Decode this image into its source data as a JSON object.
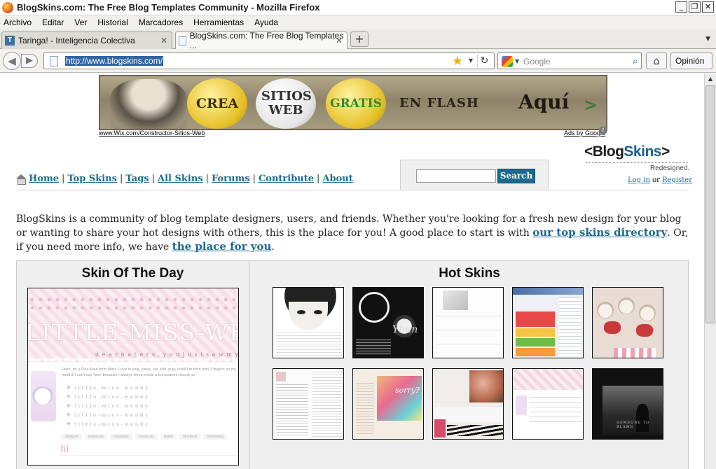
{
  "window": {
    "title": "BlogSkins.com: The Free Blog Templates Community - Mozilla Firefox",
    "buttons": [
      "_",
      "❐",
      "✕"
    ]
  },
  "menu": [
    "Archivo",
    "Editar",
    "Ver",
    "Historial",
    "Marcadores",
    "Herramientas",
    "Ayuda"
  ],
  "tabs": [
    {
      "label": "Taringa! - Inteligencia Colectiva",
      "icon": "T",
      "icon_color": "#3c6ea8",
      "active": false
    },
    {
      "label": "BlogSkins.com: The Free Blog Templates ...",
      "icon": "",
      "icon_color": "#ffffff",
      "active": true
    }
  ],
  "newtab_label": "+",
  "navbar": {
    "url": "http://www.blogskins.com/",
    "search_placeholder": "Google",
    "opinion_label": "Opinión"
  },
  "ad": {
    "bubble1": "CREA",
    "bubble2": "SITIOS WEB",
    "bubble3": "GRATIS",
    "flash": "EN FLASH",
    "aqui": "Aquí",
    "aqui_arrow": ">",
    "url": "www.Wix.com/Constructor-Sitios-Web",
    "ads_by": "Ads by Google"
  },
  "header": {
    "logo_lt": "<",
    "logo_blog": "Blog",
    "logo_skins": "Skins",
    "logo_gt": ">",
    "tagline": "Redesigned.",
    "login": "Log in",
    "or": "or",
    "register": "Register"
  },
  "nav": [
    "Home",
    "Top Skins",
    "Tags",
    "All Skins",
    "Forums",
    "Contribute",
    "About"
  ],
  "search_button": "Search",
  "intro": {
    "text1": "BlogSkins is a community of blog template designers, users, and friends. Whether you're looking for a fresh new design for your blog or wanting to share your hot designs with others, this is the place for you! A good place to start is with ",
    "link1": "our top skins directory",
    "text2": ". Or, if you need more info, we have ",
    "link2": "the place for you",
    "text3": "."
  },
  "sotd": {
    "title": "Skin Of The Day",
    "band_title": "LITTLE-MISS-WENDY",
    "band_sub": "d e a r  h a t e r s ,  y o u  j u s t  s a w  m y  g l o r y .",
    "hello": "Hello, im a Pink Alien from Mars. Love to sing, sleep, eat, talk, play, read! I'm born with 3 fingers on my hand & I can't say 'love' because I always sleep inside a transparent biscuit jar.",
    "links": [
      "little-miss-wendy",
      "little-miss-wendy",
      "little-miss-wendy",
      "little-miss-wendy",
      "little-miss-wendy"
    ],
    "tags": [
      "designer",
      "basecode",
      "resources",
      "resources",
      "twitter",
      "facebook",
      "formspring"
    ],
    "hi": "hi"
  },
  "hot": {
    "title": "Hot Skins",
    "t2_text": "Yhun",
    "t7_text": "sorry?",
    "t10_text": "SOMEONE TO BLAME"
  }
}
